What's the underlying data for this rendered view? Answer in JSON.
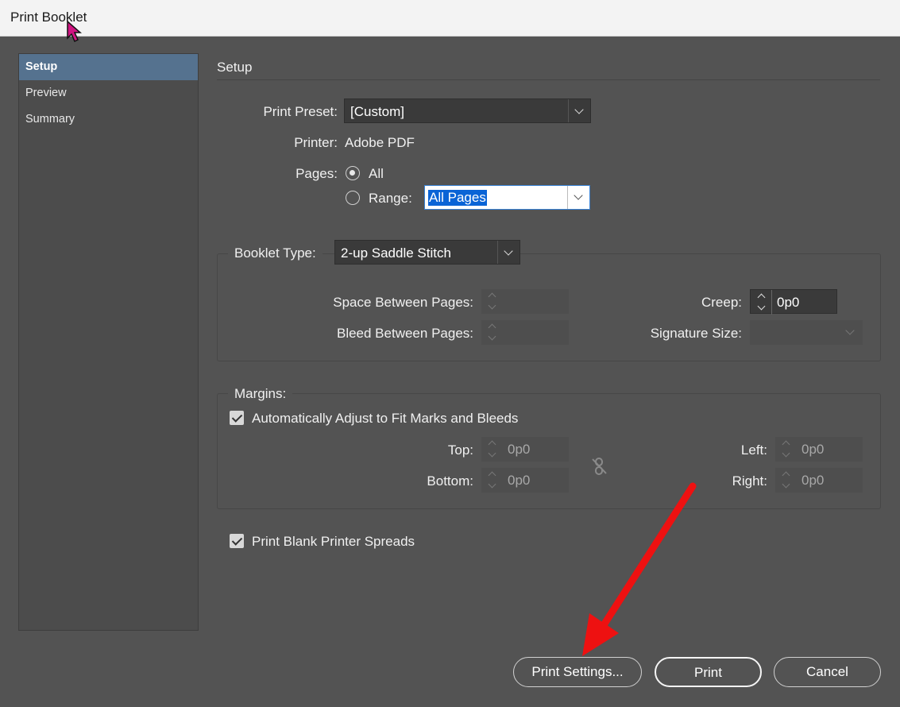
{
  "window": {
    "title": "Print Booklet"
  },
  "sidebar": {
    "items": [
      "Setup",
      "Preview",
      "Summary"
    ]
  },
  "section": {
    "title": "Setup"
  },
  "preset": {
    "label": "Print Preset:",
    "value": "[Custom]"
  },
  "printer": {
    "label": "Printer:",
    "value": "Adobe PDF"
  },
  "pages": {
    "label": "Pages:",
    "all_label": "All",
    "range_label": "Range:",
    "range_value": "All Pages",
    "selected": "All"
  },
  "booklet": {
    "label": "Booklet Type:",
    "value": "2-up Saddle Stitch"
  },
  "spacing": {
    "space_label": "Space Between Pages:",
    "bleed_label": "Bleed Between Pages:",
    "creep_label": "Creep:",
    "creep_value": "0p0",
    "signature_label": "Signature Size:"
  },
  "margins": {
    "title": "Margins:",
    "auto_label": "Automatically Adjust to Fit Marks and Bleeds",
    "auto_checked": true,
    "top_label": "Top:",
    "top_value": "0p0",
    "bottom_label": "Bottom:",
    "bottom_value": "0p0",
    "left_label": "Left:",
    "left_value": "0p0",
    "right_label": "Right:",
    "right_value": "0p0"
  },
  "blank": {
    "label": "Print Blank Printer Spreads",
    "checked": true
  },
  "buttons": {
    "print_settings": "Print Settings...",
    "print": "Print",
    "cancel": "Cancel"
  },
  "annotation": {
    "arrow_color": "#ee1111"
  }
}
